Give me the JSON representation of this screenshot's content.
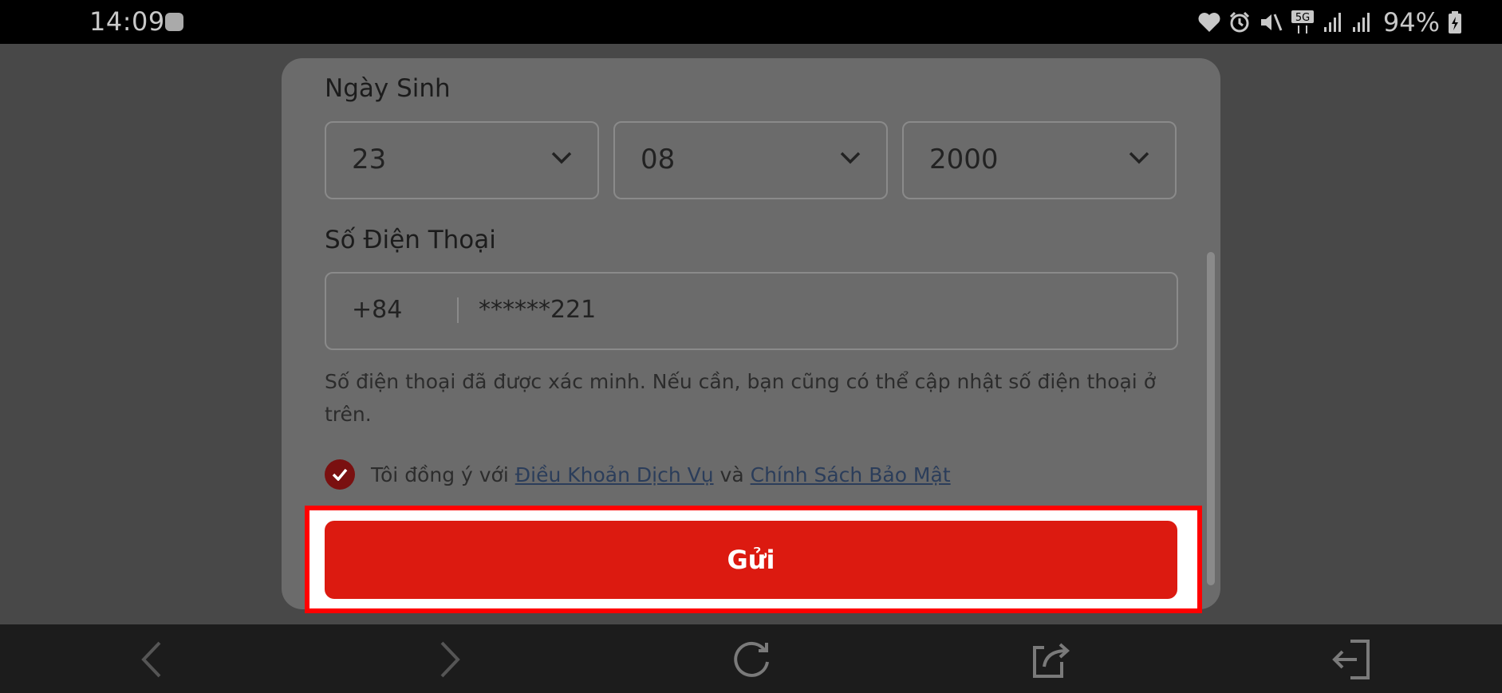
{
  "status_bar": {
    "time": "14:09",
    "network": "5G",
    "battery": "94%",
    "icons": [
      "game-app-icon",
      "heart-icon",
      "alarm-icon",
      "mute-icon",
      "5g-icon",
      "signal-icon",
      "signal-icon",
      "battery-icon"
    ]
  },
  "form": {
    "dob_label": "Ngày Sinh",
    "day": "23",
    "month": "08",
    "year": "2000",
    "phone_label": "Số Điện Thoại",
    "country_code": "+84",
    "phone": "******221",
    "phone_hint": "Số điện thoại đã được xác minh. Nếu cần, bạn cũng có thể cập nhật số điện thoại ở trên.",
    "agree_prefix": "Tôi đồng ý với",
    "terms_link": "Điều Khoản Dịch Vụ",
    "agree_and": "và",
    "privacy_link": "Chính Sách Bảo Mật",
    "agree_checked": true,
    "submit_label": "Gửi"
  },
  "colors": {
    "accent": "#dc1a10",
    "highlight": "#ff0000",
    "checkbox": "#7a1010"
  },
  "nav": {
    "icons": [
      "back-icon",
      "forward-icon",
      "refresh-icon",
      "share-icon",
      "exit-icon"
    ]
  }
}
